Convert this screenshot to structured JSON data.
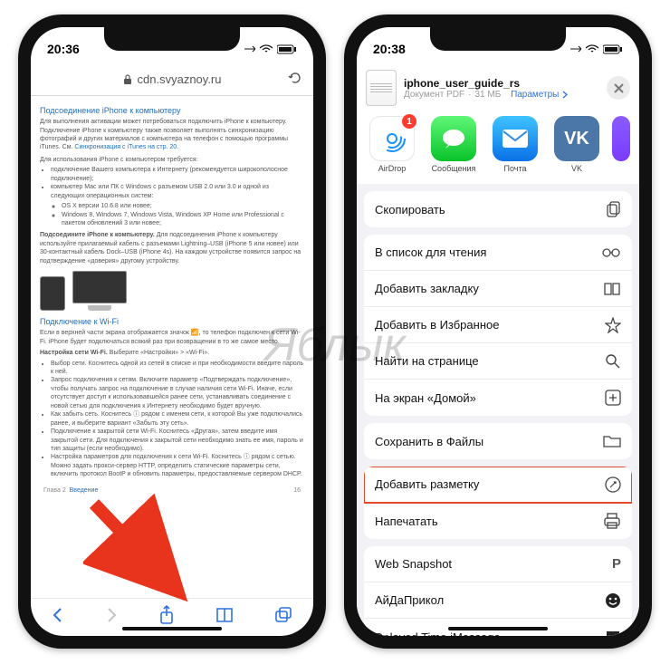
{
  "watermark": "Яблык",
  "left": {
    "time": "20:36",
    "url": "cdn.svyaznoy.ru",
    "sections": {
      "connect_title": "Подсоединение iPhone к компьютеру",
      "connect_p1": "Для выполнения активации может потребоваться подключить iPhone к компьютеру. Подключение iPhone к компьютеру также позволяет выполнять синхронизацию фотографий и других материалов с компьютера на телефон с помощью программы iTunes. См.",
      "connect_link": "Синхронизация с iTunes на стр. 20",
      "req_p": "Для использования iPhone с компьютером требуется:",
      "req1": "подключение Вашего компьютера к Интернету (рекомендуется широкополосное подключение);",
      "req2": "компьютер Mac или ПК с Windows с разъемом USB 2.0 или 3.0 и одной из следующих операционных систем:",
      "req2a": "OS X версии 10.6.8 или новее;",
      "req2b": "Windows 8, Windows 7, Windows Vista, Windows XP Home или Professional с пакетом обновлений 3 или новее;",
      "connect_bold": "Подсоедините iPhone к компьютеру.",
      "connect_p2": " Для подсоединения iPhone к компьютеру используйте прилагаемый кабель с разъемами Lightning–USB (iPhone 5 или новее) или 30-контактный кабель Dock–USB (iPhone 4s). На каждом устройстве появится запрос на подтверждение «доверия» другому устройству.",
      "wifi_title": "Подключение к Wi-Fi",
      "wifi_p1": "Если в верхней части экрана отображается значок 📶, то телефон подключен к сети Wi-Fi. iPhone будет подключаться всякий раз при возвращении в то же самое место.",
      "wifi_bold": "Настройка сети Wi-Fi.",
      "wifi_p2": " Выберите «Настройки» > «Wi-Fi».",
      "b1": "Выбор сети. Коснитесь одной из сетей в списке и при необходимости введите пароль к ней.",
      "b2": "Запрос подключения к сетям. Включите параметр «Подтверждать подключение», чтобы получать запрос на подключение в случае наличия сети Wi-Fi. Иначе, если отсутствует доступ к использовавшейся ранее сети, устанавливать соединение с новой сетью для подключения к Интернету необходимо будет вручную.",
      "b3": "Как забыть сеть. Коснитесь ⓘ рядом с именем сети, к которой Вы уже подключались ранее, и выберите вариант «Забыть эту сеть».",
      "b4": "Подключение к закрытой сети Wi-Fi. Коснитесь «Другая», затем введите имя закрытой сети. Для подключения к закрытой сети необходимо знать ее имя, пароль и тип защиты (если необходимо).",
      "b5": "Настройка параметров для подключения к сети Wi-Fi. Коснитесь ⓘ рядом с сетью. Можно задать прокси-сервер HTTP, определить статические параметры сети, включить протокол BootP и обновить параметры, предоставляемые сервером DHCP.",
      "chapter": "Глава 2",
      "section_name": "Введение",
      "page_num": "16"
    }
  },
  "right": {
    "time": "20:38",
    "doc": {
      "name": "iphone_user_guide_rs",
      "type": "Документ PDF",
      "size": "31 МБ",
      "params": "Параметры"
    },
    "airdrop_badge": "1",
    "apps": {
      "airdrop": "AirDrop",
      "messages": "Сообщения",
      "mail": "Почта",
      "vk": "VK"
    },
    "actions": {
      "copy": "Скопировать",
      "reading": "В список для чтения",
      "bookmark": "Добавить закладку",
      "favorites": "Добавить в Избранное",
      "find": "Найти на странице",
      "home": "На экран «Домой»",
      "files": "Сохранить в Файлы",
      "markup": "Добавить разметку",
      "print": "Напечатать",
      "snapshot": "Web Snapshot",
      "aida": "АйДаПрикол",
      "delayed": "Delayed Time iMessage"
    }
  }
}
